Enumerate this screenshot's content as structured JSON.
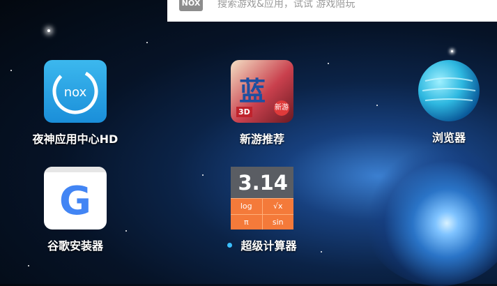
{
  "search": {
    "logo_text": "NOX",
    "placeholder": "搜索游戏&应用，试试 游戏陪玩"
  },
  "apps": [
    {
      "label": "夜神应用中心HD",
      "icon": "nox-icon",
      "icon_text": "nox"
    },
    {
      "label": "新游推荐",
      "icon": "game-icon",
      "icon_text": [
        "蓝",
        "3D",
        "新游"
      ]
    },
    {
      "label": "浏览器",
      "icon": "globe-icon"
    },
    {
      "label": "谷歌安装器",
      "icon": "google-icon",
      "icon_text": "G"
    },
    {
      "label": "超级计算器",
      "icon": "calculator-icon",
      "icon_text": [
        "3.14",
        "log",
        "√x",
        "π",
        "sin"
      ],
      "new_indicator": true
    }
  ],
  "colors": {
    "accent": "#3bbfff",
    "nox_blue": "#1a8ed9",
    "calc_orange": "#f47a3a"
  }
}
